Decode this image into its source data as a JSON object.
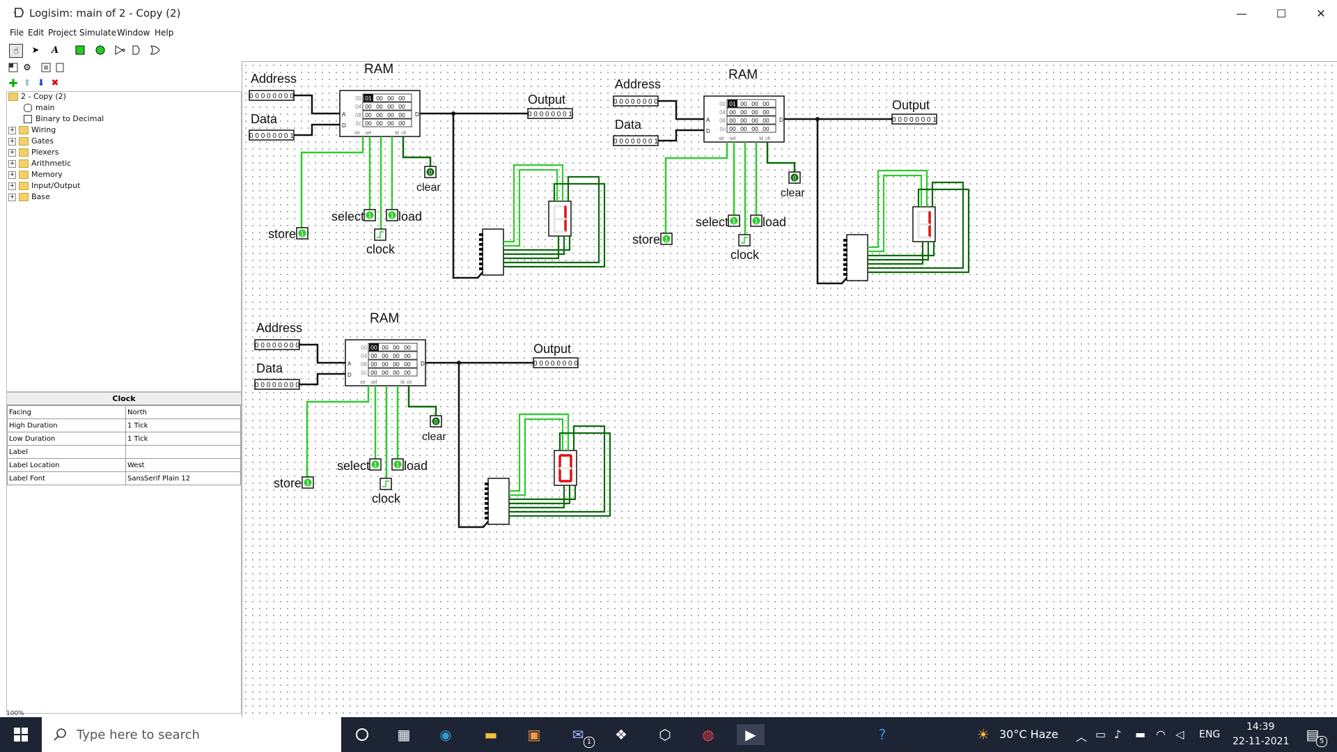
{
  "window": {
    "title": "Logisim: main of 2 - Copy (2)",
    "minimize": "—",
    "maximize": "☐",
    "close": "✕"
  },
  "menu": [
    "File",
    "Edit",
    "Project",
    "Simulate",
    "Window",
    "Help"
  ],
  "tree": {
    "root": "2 - Copy (2)",
    "items": [
      "main",
      "Binary to Decimal",
      "Wiring",
      "Gates",
      "Plexers",
      "Arithmetic",
      "Memory",
      "Input/Output",
      "Base"
    ]
  },
  "properties": {
    "title": "Clock",
    "rows": [
      {
        "key": "Facing",
        "value": "North"
      },
      {
        "key": "High Duration",
        "value": "1 Tick"
      },
      {
        "key": "Low Duration",
        "value": "1 Tick"
      },
      {
        "key": "Label",
        "value": ""
      },
      {
        "key": "Label Location",
        "value": "West"
      },
      {
        "key": "Label Font",
        "value": "SansSerif Plain 12"
      }
    ],
    "zoom": "100%"
  },
  "circuits": [
    {
      "ram_label": "RAM",
      "address_label": "Address",
      "address_value": "00000000",
      "data_label": "Data",
      "data_value": "00000001",
      "output_label": "Output",
      "output_value": "00000001",
      "mem_rows": [
        {
          "addr": "00",
          "cells": [
            "01",
            "00",
            "00",
            "00"
          ]
        },
        {
          "addr": "04",
          "cells": [
            "00",
            "00",
            "00",
            "00"
          ]
        },
        {
          "addr": "08",
          "cells": [
            "00",
            "00",
            "00",
            "00"
          ]
        },
        {
          "addr": "0c",
          "cells": [
            "00",
            "00",
            "00",
            "00"
          ]
        }
      ],
      "clear_label": "clear",
      "clear_value": "0",
      "select_label": "select",
      "select_value": "1",
      "load_label": "load",
      "load_value": "1",
      "store_label": "store",
      "store_value": "1",
      "clock_label": "clock",
      "display_digit": "1"
    },
    {
      "ram_label": "RAM",
      "address_label": "Address",
      "address_value": "00000000",
      "data_label": "Data",
      "data_value": "00000001",
      "output_label": "Output",
      "output_value": "00000001",
      "mem_rows": [
        {
          "addr": "00",
          "cells": [
            "01",
            "00",
            "00",
            "00"
          ]
        },
        {
          "addr": "04",
          "cells": [
            "00",
            "00",
            "00",
            "00"
          ]
        },
        {
          "addr": "08",
          "cells": [
            "00",
            "00",
            "00",
            "00"
          ]
        },
        {
          "addr": "0c",
          "cells": [
            "00",
            "00",
            "00",
            "00"
          ]
        }
      ],
      "clear_label": "clear",
      "clear_value": "0",
      "select_label": "select",
      "select_value": "1",
      "load_label": "load",
      "load_value": "1",
      "store_label": "store",
      "store_value": "1",
      "clock_label": "clock",
      "display_digit": "1"
    },
    {
      "ram_label": "RAM",
      "address_label": "Address",
      "address_value": "00000000",
      "data_label": "Data",
      "data_value": "00000000",
      "output_label": "Output",
      "output_value": "00000000",
      "mem_rows": [
        {
          "addr": "00",
          "cells": [
            "00",
            "00",
            "00",
            "00"
          ]
        },
        {
          "addr": "04",
          "cells": [
            "00",
            "00",
            "00",
            "00"
          ]
        },
        {
          "addr": "08",
          "cells": [
            "00",
            "00",
            "00",
            "00"
          ]
        },
        {
          "addr": "0c",
          "cells": [
            "00",
            "00",
            "00",
            "00"
          ]
        }
      ],
      "clear_label": "clear",
      "clear_value": "0",
      "select_label": "select",
      "select_value": "1",
      "load_label": "load",
      "load_value": "1",
      "store_label": "store",
      "store_value": "1",
      "clock_label": "clock",
      "display_digit": "0"
    }
  ],
  "ram_pins": {
    "a": "A",
    "d_in": "D",
    "d_out": "D",
    "bottom": [
      "str",
      "sel",
      "ld",
      "clr"
    ]
  },
  "taskbar": {
    "search_placeholder": "Type here to search",
    "weather": "30°C  Haze",
    "language": "ENG",
    "time": "14:39",
    "date": "22-11-2021",
    "mail_badge": "1",
    "notif_badge": "5"
  },
  "colors": {
    "wire_on": "#2ecc2e",
    "wire_off": "#0a6a0a",
    "wire_bus": "#111111",
    "segment_on": "#e01010",
    "taskbar": "#1d2433"
  }
}
